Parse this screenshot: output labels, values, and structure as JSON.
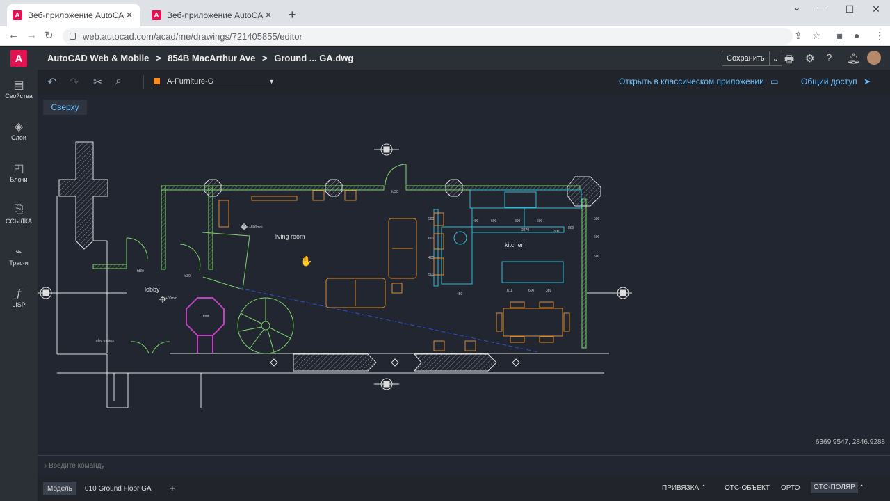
{
  "browser": {
    "tabs": [
      {
        "title": "Веб-приложение AutoCAD — о"
      },
      {
        "title": "Веб-приложение AutoCAD — о"
      }
    ],
    "new_tab": "+",
    "url": "web.autocad.com/acad/me/drawings/721405855/editor"
  },
  "header": {
    "logo": "A",
    "breadcrumbs": [
      "AutoCAD Web & Mobile",
      "854B MacArthur Ave",
      "Ground ... GA.dwg"
    ],
    "breadcrumb_sep": ">",
    "save_label": "Сохранить"
  },
  "sidebar": {
    "items": [
      {
        "label": "Свойства",
        "icon": "properties-icon"
      },
      {
        "label": "Слои",
        "icon": "layers-icon"
      },
      {
        "label": "Блоки",
        "icon": "blocks-icon"
      },
      {
        "label": "ССЫЛКА",
        "icon": "xref-icon"
      },
      {
        "label": "Трас-и",
        "icon": "trace-icon"
      },
      {
        "label": "LISP",
        "icon": "lisp-icon"
      }
    ]
  },
  "toolbar": {
    "layer_name": "A-Furniture-G",
    "layer_color": "#ff8c1a",
    "open_classic_label": "Открыть в классическом приложении",
    "share_label": "Общий доступ"
  },
  "canvas": {
    "view_label": "Сверху",
    "coordinates": "6369.9547, 2846.9288",
    "rooms": {
      "living_room": "living room",
      "kitchen": "kitchen",
      "lobby": "lobby",
      "font": "font",
      "elec_meters": "elec meters"
    },
    "annotations": {
      "level1": "+800mm",
      "level2": "+00mm",
      "fd1": "fd30",
      "fd2": "fd30",
      "fd3": "fd30",
      "dims": [
        "400",
        "600",
        "800",
        "600",
        "2370",
        "300",
        "800",
        "500",
        "600",
        "500",
        "500",
        "600",
        "400",
        "500",
        "450",
        "811",
        "600",
        "389"
      ]
    }
  },
  "command_line": {
    "placeholder": "Введите команду"
  },
  "status": {
    "model_tab": "Модель",
    "layout_tab": "010 Ground Floor GA",
    "add_layout": "+",
    "snap": "ПРИВЯЗКА",
    "otrack": "ОТС-ОБЪЕКТ",
    "ortho": "ОРТО",
    "polar": "ОТС-ПОЛЯР"
  },
  "colors": {
    "accent": "#6cc1ff",
    "brand": "#e51050",
    "wall_green": "#7fd36b",
    "furniture_orange": "#e08a2a",
    "kitchen_cyan": "#2bbcd4"
  }
}
